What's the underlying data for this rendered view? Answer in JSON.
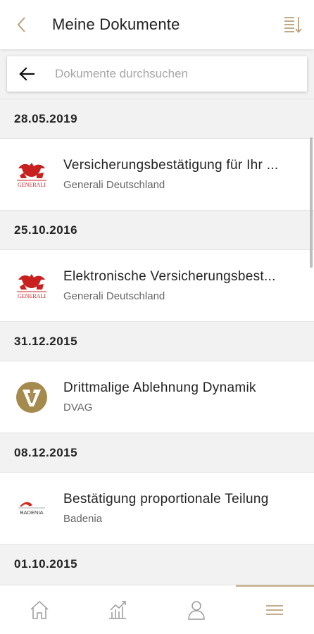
{
  "header": {
    "title": "Meine Dokumente"
  },
  "search": {
    "placeholder": "Dokumente durchsuchen"
  },
  "groups": [
    {
      "date": "28.05.2019",
      "title": "Versicherungsbestätigung für Ihr ...",
      "company": "Generali Deutschland",
      "logo": "generali-logo"
    },
    {
      "date": "25.10.2016",
      "title": "Elektronische Versicherungsbest...",
      "company": "Generali Deutschland",
      "logo": "generali-logo"
    },
    {
      "date": "31.12.2015",
      "title": "Drittmalige Ablehnung Dynamik",
      "company": "DVAG",
      "logo": "dvag-logo"
    },
    {
      "date": "08.12.2015",
      "title": "Bestätigung proportionale Teilung",
      "company": "Badenia",
      "logo": "badenia-logo"
    },
    {
      "date": "01.10.2015"
    }
  ],
  "logos": {
    "generali_text": "GENERALI",
    "badenia_text": "BADENIA"
  },
  "colors": {
    "accent": "#b9a27c",
    "generali_red": "#c8201f",
    "dvag_gold": "#a58a4e",
    "badenia_red": "#d52b1e"
  },
  "bottom_nav": [
    {
      "icon": "home-icon",
      "active": false
    },
    {
      "icon": "chart-icon",
      "active": false
    },
    {
      "icon": "profile-icon",
      "active": false
    },
    {
      "icon": "menu-icon",
      "active": true
    }
  ]
}
